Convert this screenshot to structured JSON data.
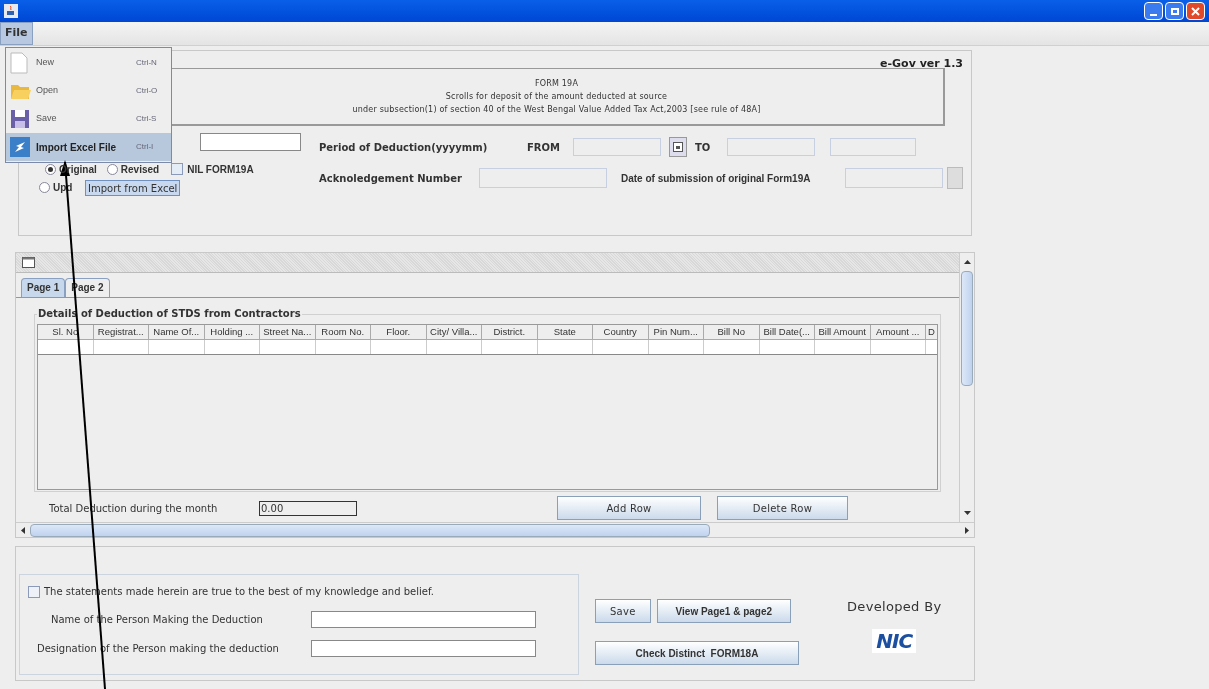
{
  "menu": [
    {
      "label": "File",
      "selected": true
    }
  ],
  "file_menu": [
    {
      "label": "New",
      "shortcut": "Ctrl-N",
      "selected": false
    },
    {
      "label": "Open",
      "shortcut": "Ctrl-O",
      "selected": false
    },
    {
      "label": "Save",
      "shortcut": "Ctrl-S",
      "selected": false
    },
    {
      "label": "Import Excel File",
      "shortcut": "Ctrl-I",
      "selected": true
    }
  ],
  "tooltip": "Import from Excel",
  "header": {
    "version": "e-Gov ver 1.3",
    "title_lines": [
      "FORM 19A",
      "Scrolls for deposit of the amount deducted at source",
      "under subsection(1) of section 40 of the West Bengal Value Added Tax Act,2003 [see rule of 48A]"
    ]
  },
  "form": {
    "radios": [
      {
        "label": "Original",
        "selected": true
      },
      {
        "label": "Revised",
        "selected": false
      },
      {
        "label": "Upd",
        "selected": false
      }
    ],
    "nil_checkbox": {
      "label": "NIL FORM19A",
      "checked": false
    },
    "period_label": "Period of Deduction(yyyymm)",
    "from_label": "FROM",
    "to_label": "TO",
    "ack_label": "Acknoledgement Number",
    "date_label": "Date of submission of original Form19A"
  },
  "tabs": [
    {
      "label": "Page 1",
      "selected": true
    },
    {
      "label": "Page 2",
      "selected": false
    }
  ],
  "table": {
    "title": "Details of Deduction of STDS from Contractors",
    "columns": [
      "Sl. No",
      "Registrat...",
      "Name  Of...",
      "Holding ...",
      "Street Na...",
      "Room No.",
      "Floor.",
      "City/ Villa...",
      "District.",
      "State",
      "Country",
      "Pin Num...",
      "Bill No",
      "Bill Date(...",
      "Bill Amount",
      "Amount ...",
      "D"
    ]
  },
  "total": {
    "label": "Total Deduction during the month",
    "value": "0.00"
  },
  "table_buttons": [
    "Add Row",
    "Delete Row"
  ],
  "declaration": {
    "statement": "The statements made herein are true to the best of my knowledge and belief.",
    "checked": false,
    "name_label": "Name of the Person Making the Deduction",
    "designation_label": "Designation of the Person making the deduction"
  },
  "buttons": [
    {
      "label": "Save",
      "kind": "plain"
    },
    {
      "label": "View Page1 & page2",
      "kind": "bold"
    },
    {
      "label": "Check Distinct  FORM18A",
      "kind": "bold"
    }
  ],
  "developed_by": "Developed By",
  "logo": "NIC"
}
